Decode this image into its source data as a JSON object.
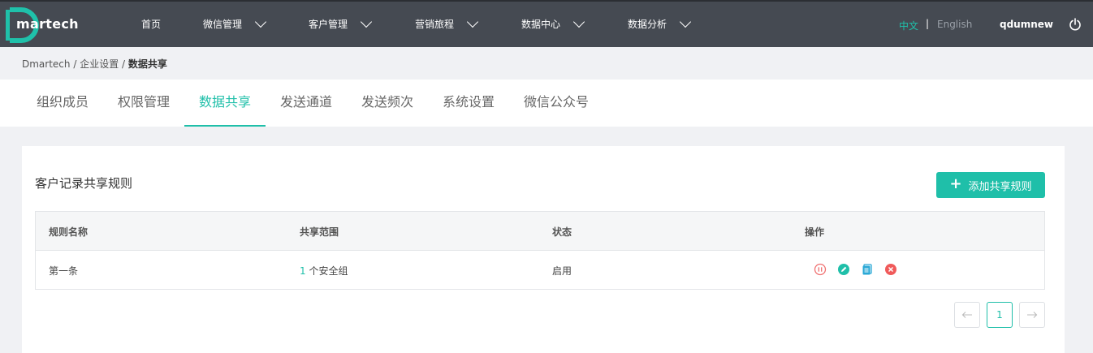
{
  "header": {
    "logo_text": "martech",
    "nav": [
      {
        "label": "首页",
        "has_dropdown": false
      },
      {
        "label": "微信管理",
        "has_dropdown": true
      },
      {
        "label": "客户管理",
        "has_dropdown": true
      },
      {
        "label": "营销旅程",
        "has_dropdown": true
      },
      {
        "label": "数据中心",
        "has_dropdown": true
      },
      {
        "label": "数据分析",
        "has_dropdown": true
      }
    ],
    "lang_zh": "中文",
    "lang_sep": "|",
    "lang_en": "English",
    "username": "qdumnew",
    "power_icon": "power-icon"
  },
  "breadcrumb": {
    "items": [
      "Dmartech",
      "企业设置",
      "数据共享"
    ],
    "sep": " / "
  },
  "tabs": {
    "items": [
      "组织成员",
      "权限管理",
      "数据共享",
      "发送通道",
      "发送频次",
      "系统设置",
      "微信公众号"
    ],
    "active_index": 2
  },
  "card": {
    "title": "客户记录共享规则",
    "add_button": "添加共享规则",
    "table": {
      "headers": [
        "规则名称",
        "共享范围",
        "状态",
        "操作"
      ],
      "rows": [
        {
          "name": "第一条",
          "scope_count": "1",
          "scope_text": " 个安全组",
          "status": "启用"
        }
      ]
    },
    "pager": {
      "current": "1"
    }
  },
  "colors": {
    "accent": "#1fbfa9",
    "topbar": "#454a52",
    "pause": "#f07070",
    "edit": "#1fbfa9",
    "copy": "#2aa8d6",
    "delete": "#f05a5a"
  }
}
